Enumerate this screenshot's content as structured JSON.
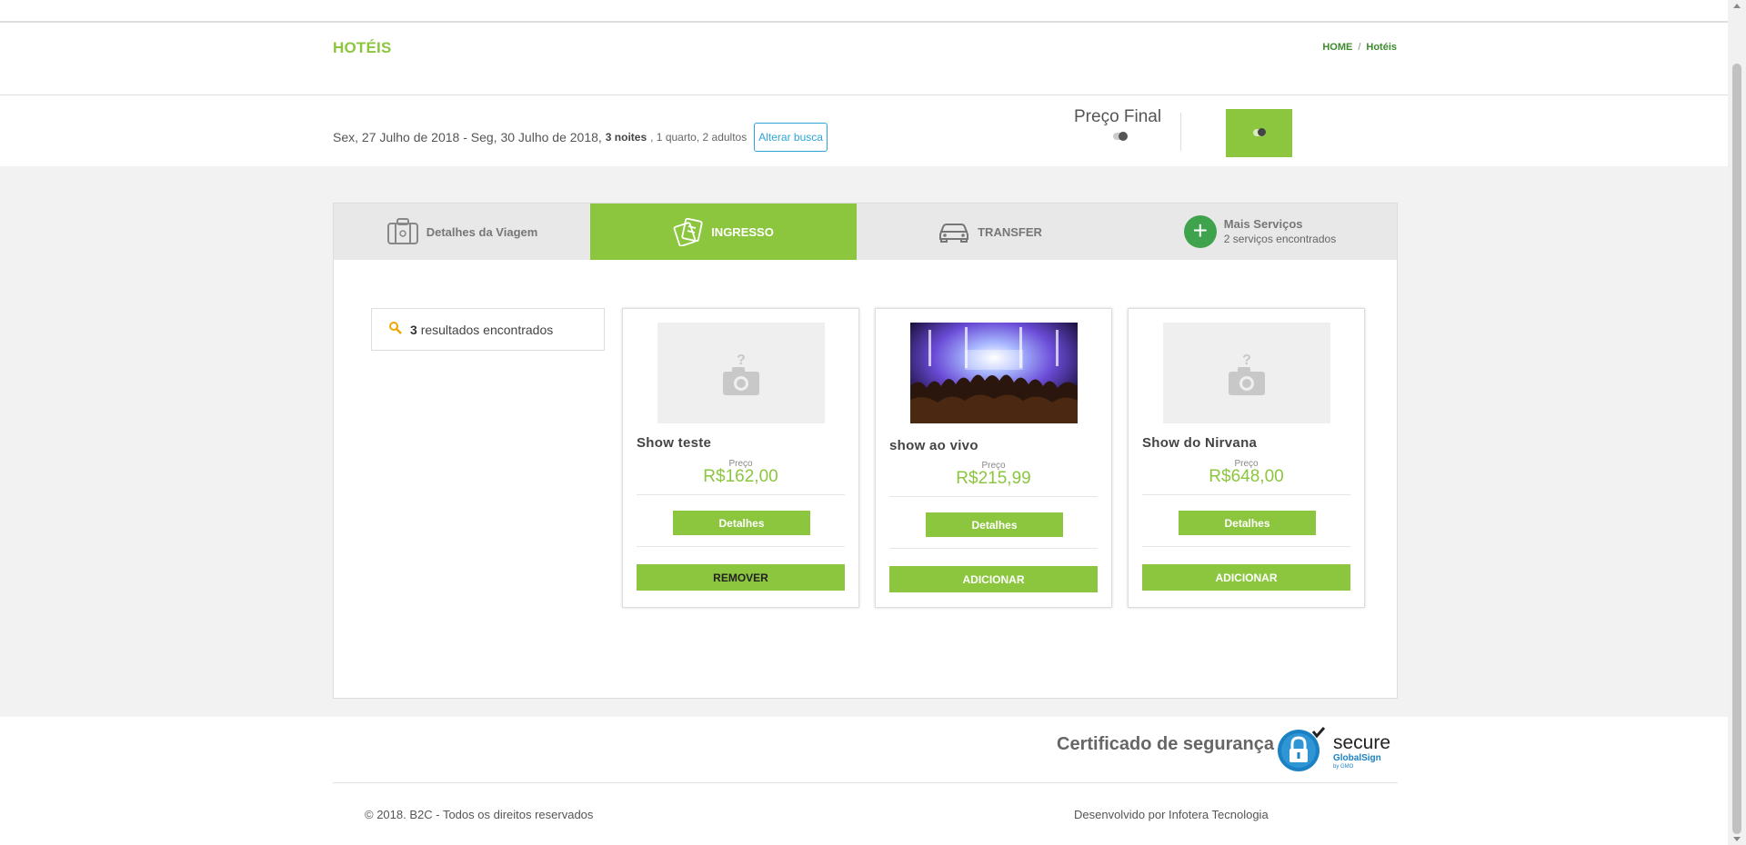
{
  "header": {
    "title": "HOTÉIS",
    "breadcrumb": {
      "home": "HOME",
      "separator": "/",
      "current": "Hotéis"
    }
  },
  "search": {
    "dates": "Sex, 27 Julho de 2018 - Seg, 30 Julho de 2018,",
    "nights": "3 noites",
    "rooms_guests": ", 1 quarto, 2 adultos",
    "alter_label": "Alterar busca",
    "price_final_label": "Preço Final"
  },
  "tabs": [
    {
      "label": "Detalhes da Viagem",
      "icon": "suitcase-icon"
    },
    {
      "label": "INGRESSO",
      "icon": "ticket-icon"
    },
    {
      "label": "TRANSFER",
      "icon": "car-icon"
    },
    {
      "label": "Mais Serviços",
      "sub": "2 serviços encontrados",
      "icon": "plus-icon"
    }
  ],
  "results": {
    "count": "3",
    "text": "resultados encontrados"
  },
  "cards": [
    {
      "title": "Show teste",
      "price_label": "Preço",
      "price": "R$162,00",
      "details": "Detalhes",
      "action": "REMOVER",
      "image": "placeholder-camera"
    },
    {
      "title": "show ao vivo",
      "price_label": "Preço",
      "price": "R$215,99",
      "details": "Detalhes",
      "action": "ADICIONAR",
      "image": "concert-photo"
    },
    {
      "title": "Show do Nirvana",
      "price_label": "Preço",
      "price": "R$648,00",
      "details": "Detalhes",
      "action": "ADICIONAR",
      "image": "placeholder-camera"
    }
  ],
  "footer": {
    "certificate": "Certificado de segurança",
    "badge_secure": "secure",
    "badge_globalsign": "GlobalSign",
    "badge_gmo": "by GMO",
    "copyright": "© 2018. B2C - Todos os direitos reservados",
    "developed": "Desenvolvido por Infotera Tecnologia"
  },
  "colors": {
    "accent": "#8cc63f",
    "dark_green": "#3c8a2e",
    "link_blue": "#2fa4d6"
  }
}
